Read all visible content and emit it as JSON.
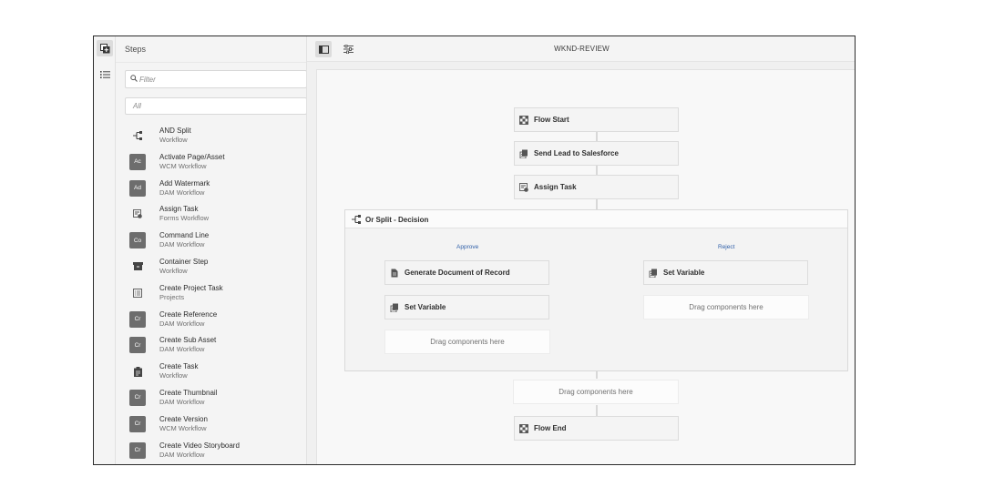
{
  "steps_panel": {
    "title": "Steps",
    "filter_placeholder": "Filter",
    "category": "All",
    "items": [
      {
        "name": "AND Split",
        "sub": "Workflow",
        "icon": "and-split-icon"
      },
      {
        "name": "Activate Page/Asset",
        "sub": "WCM Workflow",
        "badge": "Ac"
      },
      {
        "name": "Add Watermark",
        "sub": "DAM Workflow",
        "badge": "Ad"
      },
      {
        "name": "Assign Task",
        "sub": "Forms Workflow",
        "icon": "assign-task-icon"
      },
      {
        "name": "Command Line",
        "sub": "DAM Workflow",
        "badge": "Co"
      },
      {
        "name": "Container Step",
        "sub": "Workflow",
        "icon": "container-icon"
      },
      {
        "name": "Create Project Task",
        "sub": "Projects",
        "icon": "project-task-icon"
      },
      {
        "name": "Create Reference",
        "sub": "DAM Workflow",
        "badge": "Cr"
      },
      {
        "name": "Create Sub Asset",
        "sub": "DAM Workflow",
        "badge": "Cr"
      },
      {
        "name": "Create Task",
        "sub": "Workflow",
        "icon": "clipboard-icon"
      },
      {
        "name": "Create Thumbnail",
        "sub": "DAM Workflow",
        "badge": "Cr"
      },
      {
        "name": "Create Version",
        "sub": "WCM Workflow",
        "badge": "Cr"
      },
      {
        "name": "Create Video Storyboard",
        "sub": "DAM Workflow",
        "badge": "Cr"
      }
    ]
  },
  "editor": {
    "title": "WKND-REVIEW",
    "nodes": {
      "flow_start": "Flow Start",
      "send_lead": "Send Lead to Salesforce",
      "assign_task": "Assign Task",
      "or_split": "Or Split - Decision",
      "approve_label": "Approve",
      "reject_label": "Reject",
      "generate_doc": "Generate Document of Record",
      "set_variable_left": "Set Variable",
      "set_variable_right": "Set Variable",
      "drag_left": "Drag components here",
      "drag_right": "Drag components here",
      "drag_main": "Drag components here",
      "flow_end": "Flow End"
    }
  },
  "colors": {
    "branch_label": "#2f5fa8",
    "badge": "#6d6d6d"
  }
}
